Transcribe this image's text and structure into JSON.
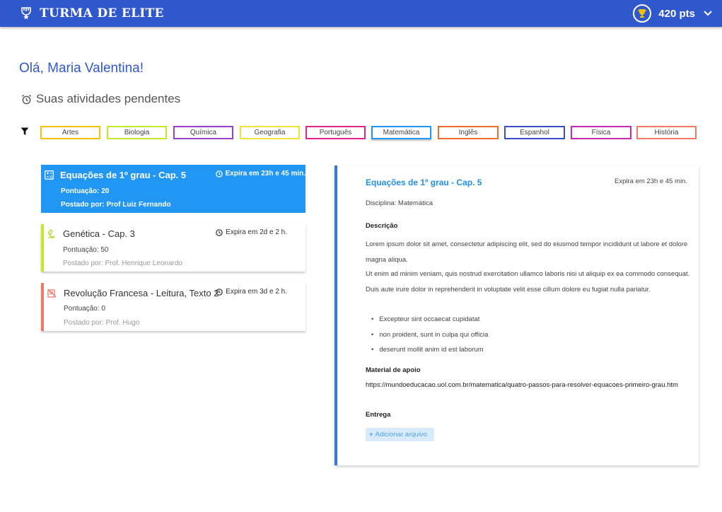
{
  "header": {
    "brand": "TURMA DE ELITE",
    "points": "420 pts"
  },
  "greeting": "Olá, Maria Valentina!",
  "pending_title": "Suas atividades pendentes",
  "filters": [
    {
      "label": "Artes",
      "color": "#f4c20d"
    },
    {
      "label": "Biologia",
      "color": "#c6e82a"
    },
    {
      "label": "Química",
      "color": "#9b3fd1"
    },
    {
      "label": "Geografia",
      "color": "#f1e23a"
    },
    {
      "label": "Português",
      "color": "#e0248a"
    },
    {
      "label": "Matemática",
      "color": "#2196f3"
    },
    {
      "label": "Inglês",
      "color": "#ef6c2a"
    },
    {
      "label": "Espanhol",
      "color": "#3a4fc7"
    },
    {
      "label": "Física",
      "color": "#c62ab3"
    },
    {
      "label": "História",
      "color": "#f07a6a"
    }
  ],
  "activities": [
    {
      "title": "Equações de 1º grau - Cap. 5",
      "expires": "Expira em 23h e 45 min.",
      "score": "Pontuação: 20",
      "posted_by": "Postado por: Prof Luiz Fernando",
      "icon": "calculator-icon"
    },
    {
      "title": "Genética - Cap. 3",
      "expires": "Expira em 2d e 2 h.",
      "score": "Pontuação: 50",
      "posted_by": "Postado por: Prof. Henrique Leonardo",
      "icon": "microscope-icon"
    },
    {
      "title": "Revolução Francesa - Leitura, Texto 2",
      "expires": "Expira em 3d e 2 h.",
      "score": "Pontuação: 0",
      "posted_by": "Postado por: Prof. Hugo",
      "icon": "history-icon"
    }
  ],
  "detail": {
    "title": "Equações de 1º grau - Cap. 5",
    "expires": "Expira em 23h e 45 min.",
    "subject": "Disciplina: Matemática",
    "description_label": "Descrição",
    "paragraph1": "Lorem ipsum dolor sit amet, consectetur adipiscing elit, sed do eiusmod tempor incididunt ut labore et dolore magna aliqua.",
    "paragraph2": "Ut enim ad minim veniam, quis nostrud exercitation ullamco laboris nisi ut aliquip ex ea commodo consequat. Duis aute irure dolor in reprehenderit in voluptate velit esse cillum dolore eu fugiat nulla pariatur.",
    "bullets": [
      "Excepteur sint occaecat cupidatat",
      "non proident, sunt in culpa qui officia",
      "deserunt mollit anim id est laborum"
    ],
    "material_label": "Material de apoio",
    "material_link": "https://mundoeducacao.uol.com.br/matematica/quatro-passos-para-resolver-equacoes-primeiro-grau.htm",
    "delivery_label": "Entrega",
    "add_file": "Adicionar arquivo"
  }
}
